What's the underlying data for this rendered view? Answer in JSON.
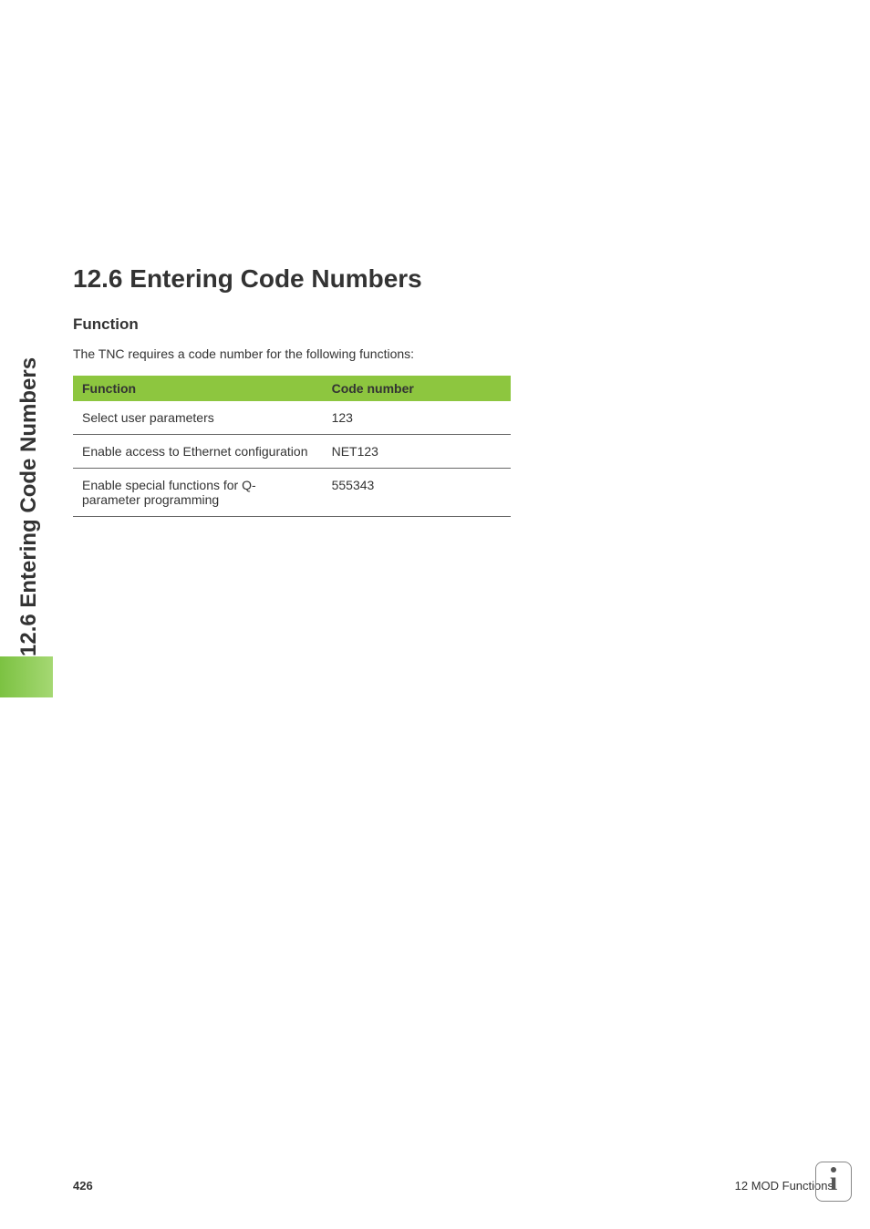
{
  "side_tab": "12.6 Entering Code Numbers",
  "section": {
    "title": "12.6 Entering Code Numbers",
    "subsection": "Function",
    "intro": "The TNC requires a code number for the following functions:"
  },
  "table": {
    "headers": {
      "function": "Function",
      "code": "Code number"
    },
    "rows": [
      {
        "function": "Select user parameters",
        "code": "123"
      },
      {
        "function": "Enable access to Ethernet configuration",
        "code": "NET123"
      },
      {
        "function": "Enable special functions for Q-parameter programming",
        "code": "555343"
      }
    ]
  },
  "footer": {
    "page": "426",
    "chapter": "12 MOD Functions"
  }
}
